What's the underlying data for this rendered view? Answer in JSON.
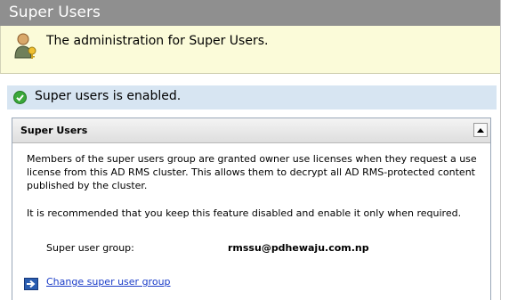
{
  "window": {
    "title": "Super Users"
  },
  "banner": {
    "text": "The administration for Super Users.",
    "icon": "user-key-icon"
  },
  "status": {
    "text": "Super users is enabled.",
    "icon": "check-circle-icon",
    "color": "#3aa83a"
  },
  "panel": {
    "title": "Super Users",
    "collapse_icon": "chevron-up-icon",
    "description": "Members of the super users group are granted owner use licenses when they request a use license from this AD RMS cluster. This allows them to decrypt all AD RMS-protected content published by the cluster.",
    "recommendation": "It is recommended that you keep this feature disabled and enable it only when required.",
    "group_label": "Super user group:",
    "group_value": "rmssu@pdhewaju.com.np",
    "action": {
      "label": "Change super user group",
      "icon": "arrow-right-icon"
    }
  }
}
